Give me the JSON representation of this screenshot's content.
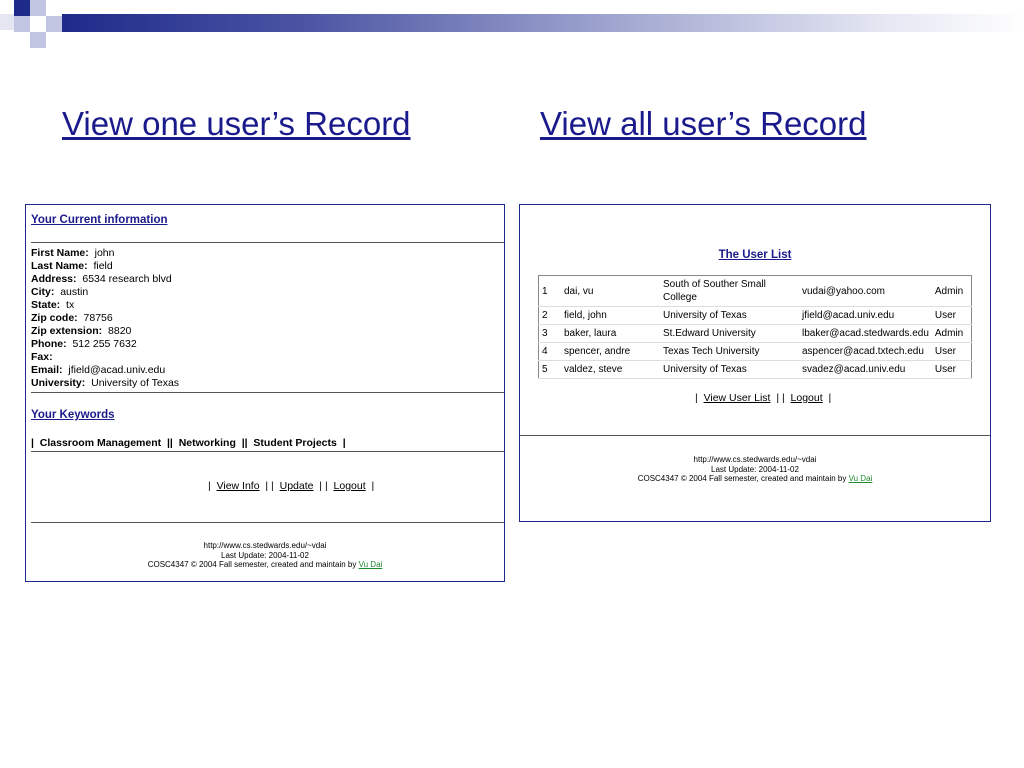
{
  "titles": {
    "left": "View one user’s Record",
    "right": "View all user’s Record"
  },
  "one_user": {
    "section_info": "Your Current information",
    "fields": [
      {
        "label": "First Name:",
        "value": "john"
      },
      {
        "label": "Last Name:",
        "value": "field"
      },
      {
        "label": "Address:",
        "value": "6534 research blvd"
      },
      {
        "label": "City:",
        "value": "austin"
      },
      {
        "label": "State:",
        "value": "tx"
      },
      {
        "label": "Zip code:",
        "value": "78756"
      },
      {
        "label": "Zip extension:",
        "value": "8820"
      },
      {
        "label": "Phone:",
        "value": "512 255 7632"
      },
      {
        "label": "Fax:",
        "value": ""
      },
      {
        "label": "Email:",
        "value": "jfield@acad.univ.edu"
      },
      {
        "label": "University:",
        "value": "University of Texas"
      }
    ],
    "section_keywords": "Your Keywords",
    "keywords": [
      "Classroom Management",
      "Networking",
      "Student Projects"
    ],
    "nav": {
      "view_info": "View Info",
      "update": "Update",
      "logout": "Logout"
    },
    "footer": {
      "url": "http://www.cs.stedwards.edu/~vdai",
      "last_update": "Last Update: 2004-11-02",
      "credit": "COSC4347 © 2004 Fall semester, created and maintain by",
      "author": "Vu Dai"
    }
  },
  "all_users": {
    "title": "The User List",
    "rows": [
      {
        "num": "1",
        "name": "dai, vu",
        "univ": "South of Souther Small College",
        "email": "vudai@yahoo.com",
        "role": "Admin"
      },
      {
        "num": "2",
        "name": "field, john",
        "univ": "University of Texas",
        "email": "jfield@acad.univ.edu",
        "role": "User"
      },
      {
        "num": "3",
        "name": "baker, laura",
        "univ": "St.Edward University",
        "email": "lbaker@acad.stedwards.edu",
        "role": "Admin"
      },
      {
        "num": "4",
        "name": "spencer, andre",
        "univ": "Texas Tech University",
        "email": "aspencer@acad.txtech.edu",
        "role": "User"
      },
      {
        "num": "5",
        "name": "valdez, steve",
        "univ": "University of Texas",
        "email": "svadez@acad.univ.edu",
        "role": "User"
      }
    ],
    "nav": {
      "view_user_list": "View User List",
      "logout": "Logout"
    },
    "footer": {
      "url": "http://www.cs.stedwards.edu/~vdai",
      "last_update": "Last Update: 2004-11-02",
      "credit": "COSC4347 © 2004 Fall semester, created and maintain by",
      "author": "Vu Dai"
    }
  },
  "colors": {
    "link_blue": "#1a1a8c",
    "header_blue": "#1e2a8a",
    "author_green": "#1f8a2f"
  }
}
